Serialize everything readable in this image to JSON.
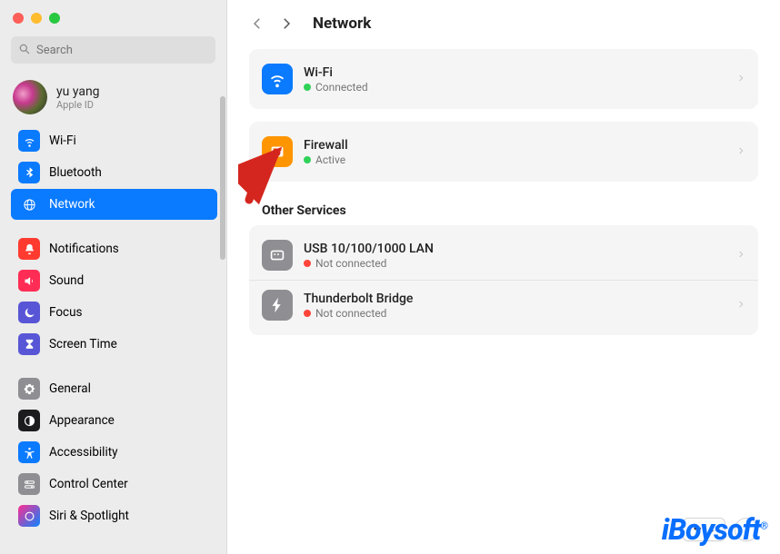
{
  "window": {
    "title": "Network"
  },
  "search": {
    "placeholder": "Search"
  },
  "user": {
    "name": "yu yang",
    "sub": "Apple ID"
  },
  "sidebar": {
    "items": [
      {
        "label": "Wi-Fi",
        "icon": "wifi",
        "color": "#0a7aff"
      },
      {
        "label": "Bluetooth",
        "icon": "bluetooth",
        "color": "#0a7aff"
      },
      {
        "label": "Network",
        "icon": "globe-net",
        "color": "#0a7aff",
        "selected": true
      },
      {
        "label": "Notifications",
        "icon": "bell",
        "color": "#ff3b30"
      },
      {
        "label": "Sound",
        "icon": "speaker",
        "color": "#ff2d55"
      },
      {
        "label": "Focus",
        "icon": "moon",
        "color": "#5856d6"
      },
      {
        "label": "Screen Time",
        "icon": "hourglass",
        "color": "#5856d6"
      },
      {
        "label": "General",
        "icon": "gear",
        "color": "#8e8e93"
      },
      {
        "label": "Appearance",
        "icon": "appearance",
        "color": "#1c1c1e"
      },
      {
        "label": "Accessibility",
        "icon": "accessibility",
        "color": "#0a7aff"
      },
      {
        "label": "Control Center",
        "icon": "switches",
        "color": "#8e8e93"
      },
      {
        "label": "Siri & Spotlight",
        "icon": "siri",
        "color": "#1c1c1e"
      }
    ]
  },
  "main": {
    "primary": [
      {
        "title": "Wi-Fi",
        "status": "Connected",
        "dot": "green",
        "icon": "wifi",
        "color": "#0a7aff"
      },
      {
        "title": "Firewall",
        "status": "Active",
        "dot": "green",
        "icon": "firewall",
        "color": "#ff9500"
      }
    ],
    "other_title": "Other Services",
    "other": [
      {
        "title": "USB 10/100/1000 LAN",
        "status": "Not connected",
        "dot": "red",
        "icon": "ethernet",
        "color": "#8e8e93"
      },
      {
        "title": "Thunderbolt Bridge",
        "status": "Not connected",
        "dot": "red",
        "icon": "thunderbolt",
        "color": "#8e8e93"
      }
    ],
    "more_label": "•••",
    "help_label": "?"
  },
  "watermark": "iBoysoft",
  "annotation": {
    "arrow": true
  }
}
